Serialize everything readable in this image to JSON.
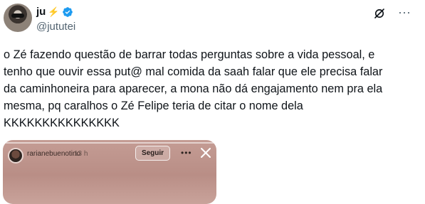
{
  "author": {
    "display_name": "ju",
    "name_emoji": "⚡",
    "handle": "@jututei",
    "verified": true
  },
  "icons": {
    "verified": "verified-badge-icon",
    "grok": "grok-icon",
    "more": "more-options-icon"
  },
  "more_glyph": "···",
  "tweet": {
    "text": "o Zé fazendo questão de barrar todas perguntas sobre a vida pessoal, e\ntenho que ouvir essa put@ mal comida da saah falar que ele precisa falar\nda caminhoneira para aparecer, a mona não dá engajamento nem pra ela\nmesma, pq caralhos o Zé Felipe teria de citar o nome dela\nKKKKKKKKKKKKKKK"
  },
  "media": {
    "story_username": "rarianebuenotino",
    "story_time": "13 h",
    "follow_label": "Seguir",
    "more_glyph": "•••"
  },
  "colors": {
    "accent": "#1d9bf0",
    "text": "#0f1419",
    "secondary_text": "#536471"
  }
}
